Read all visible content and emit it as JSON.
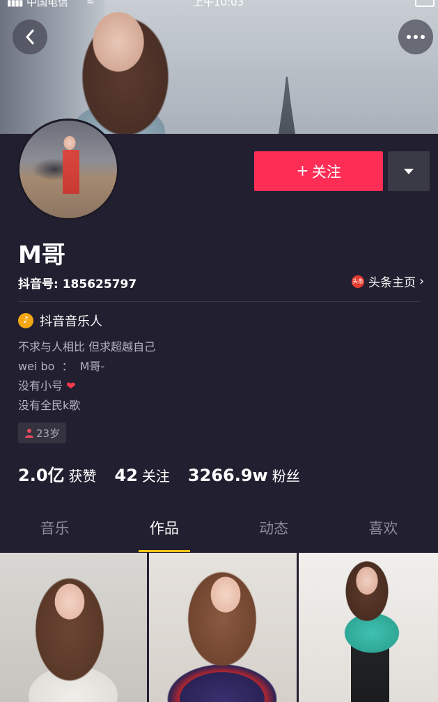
{
  "status_bar": {
    "signal": "▮▮▮▮",
    "carrier": "中国电信",
    "wifi": "≋",
    "time": "上午10:03"
  },
  "nav": {
    "back_icon": "chevron-left-icon",
    "more_icon": "more-dots-icon"
  },
  "profile": {
    "follow_label": "关注",
    "follow_plus": "+",
    "nickname": "M哥",
    "douyin_id": "抖音号: 185625797",
    "toutiao_link": "头条主页",
    "toutiao_icon_text": "头条",
    "badge": "抖音音乐人",
    "badge_icon_glyph": "♪",
    "bio": [
      "不求与人相比 但求超越自己",
      "wei bo  ：  M哥-",
      "没有小号 ",
      "没有全民k歌"
    ],
    "bio_heart": "❤",
    "age_tag": "23岁"
  },
  "stats": [
    {
      "value": "2.0亿",
      "label": "获赞"
    },
    {
      "value": "42",
      "label": "关注"
    },
    {
      "value": "3266.9w",
      "label": "粉丝"
    }
  ],
  "tabs": [
    {
      "label": "音乐",
      "active": false
    },
    {
      "label": "作品",
      "active": true
    },
    {
      "label": "动态",
      "active": false
    },
    {
      "label": "喜欢",
      "active": false
    }
  ],
  "colors": {
    "background": "#222030",
    "follow_button": "#fd2d55",
    "tab_indicator": "#f3c316",
    "heart": "#ff3b4e"
  }
}
